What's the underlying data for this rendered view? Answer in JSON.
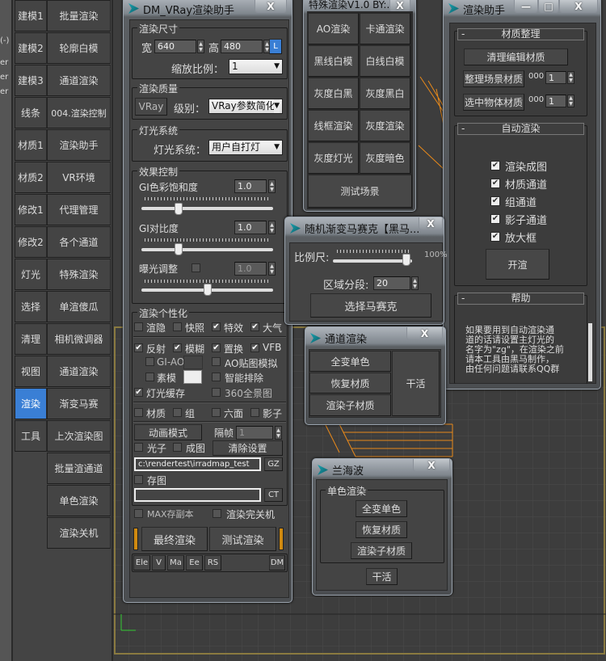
{
  "left_panel": {
    "fragments": [
      "(-)",
      "er",
      "er",
      "er"
    ]
  },
  "categories": [
    "建模1",
    "建模2",
    "建模3",
    "线条",
    "材质1",
    "材质2",
    "修改1",
    "修改2",
    "灯光",
    "选择",
    "清理",
    "视图",
    "渲染",
    "工具"
  ],
  "active_category": "渲染",
  "tools": [
    "批量渲染",
    "轮廓白模",
    "通道渲染",
    "004.渲染控制",
    "渲染助手",
    "VR环境",
    "代理管理",
    "各个通道",
    "特殊渲染",
    "单渲傻瓜",
    "相机微调器",
    "通道渲染",
    "渐变马赛",
    "上次渲染图",
    "批量渲通道",
    "单色渲染",
    "渲染关机"
  ],
  "dm": {
    "title": "DM_VRay渲染助手",
    "close": "X",
    "size": {
      "label": "渲染尺寸",
      "w_label": "宽",
      "w": "640",
      "h_label": "高",
      "h": "480",
      "lock": "L",
      "scale_label": "缩放比例：",
      "scale": "1"
    },
    "quality": {
      "label": "渲染质量",
      "vray_btn": "VRay",
      "level_label": "级别：",
      "level": "VRay参数简化"
    },
    "light": {
      "label": "灯光系统",
      "sys_label": "灯光系统：",
      "sys": "用户自打灯"
    },
    "effects": {
      "label": "效果控制",
      "gi_sat": "GI色彩饱和度",
      "gi_sat_val": "1.0",
      "gi_sat_pos": 0.28,
      "gi_con": "GI对比度",
      "gi_con_val": "1.0",
      "gi_con_pos": 0.28,
      "exposure": "曝光调整",
      "exposure_val": "1.0",
      "exposure_pos": 0.5
    },
    "personal": {
      "label": "渲染个性化",
      "row1": [
        {
          "l": "渲隐",
          "c": false
        },
        {
          "l": "快照",
          "c": false
        },
        {
          "l": "特效",
          "c": true
        },
        {
          "l": "大气",
          "c": true
        }
      ],
      "row2": [
        {
          "l": "反射",
          "c": true
        },
        {
          "l": "模糊",
          "c": true
        },
        {
          "l": "置换",
          "c": true
        },
        {
          "l": "VFB",
          "c": true
        }
      ],
      "giao": "GI-AO",
      "ao_map": "AO贴图模拟",
      "clay": "素模",
      "smart_ex": "智能排除",
      "light_cache": "灯光缓存",
      "pano": "360全景图",
      "row5": [
        {
          "l": "材质",
          "c": false
        },
        {
          "l": "组",
          "c": false
        },
        {
          "l": "六面",
          "c": false
        },
        {
          "l": "影子",
          "c": false
        }
      ],
      "anim_btn": "动画模式",
      "skip_label": "隔帧",
      "skip": "1",
      "photon": "光子",
      "final_img": "成图",
      "clear_btn": "清除设置",
      "path": "c:\\rendertest\\irradmap_test",
      "gz": "GZ",
      "save_img": "存图",
      "save_path": "",
      "ct": "CT"
    },
    "max_copy": "MAX存副本",
    "shutdown": "渲染完关机",
    "final_render": "最终渲染",
    "test_render": "测试渲染",
    "bottom_btns": [
      "Ele",
      "V",
      "Ma",
      "Ee",
      "RS"
    ],
    "dm_btn": "DM"
  },
  "special": {
    "title": "特殊渲染V1.0 BY:...",
    "close": "X",
    "buttons": [
      "AO渲染",
      "卡通渲染",
      "黑线白模",
      "白线白模",
      "灰度白黑",
      "灰度黑白",
      "线框渲染",
      "灰度渲染",
      "灰度灯光",
      "灰度暗色"
    ],
    "test_scene": "测试场景"
  },
  "helper": {
    "title": "渲染助手",
    "min": "—",
    "max": "□",
    "close": "X",
    "sec1": "材质整理",
    "clean_btn": "清理编辑材质",
    "scene_btn": "整理场景材质",
    "scene_prefix": "000",
    "scene_val": "1",
    "sel_btn": "选中物体材质",
    "sel_prefix": "000",
    "sel_val": "1",
    "sec2": "自动渲染",
    "checks": [
      "渲染成图",
      "材质通道",
      "组通道",
      "影子通道",
      "放大框"
    ],
    "start_btn": "开渲",
    "sec3": "帮助",
    "help_lines": [
      "如果要用到自动渲染通",
      "道的话请设置主灯光的",
      "名字为\"zg\"，在渲染之前",
      "请本工具由黑马制作，",
      "由任何问题请联系QQ群"
    ],
    "collapse": "-"
  },
  "mosaic": {
    "title": "随机渐变马赛克【黑马...",
    "close": "X",
    "scale_label": "比例尺:",
    "scale_val": "100%",
    "scale_pos": 0.93,
    "seg_label": "区域分段:",
    "seg": "20",
    "select_btn": "选择马赛克"
  },
  "channel": {
    "title": "通道渲染",
    "close": "X",
    "b1": "全变单色",
    "b2": "恢复材质",
    "b3": "渲染子材质",
    "work": "干活"
  },
  "lan": {
    "title": "兰海波",
    "close": "X",
    "group": "单色渲染",
    "b1": "全变单色",
    "b2": "恢复材质",
    "b3": "渲染子材质",
    "work": "干活"
  },
  "colors": {
    "accent": "#3a7fd5",
    "wire": "#e8891a"
  }
}
